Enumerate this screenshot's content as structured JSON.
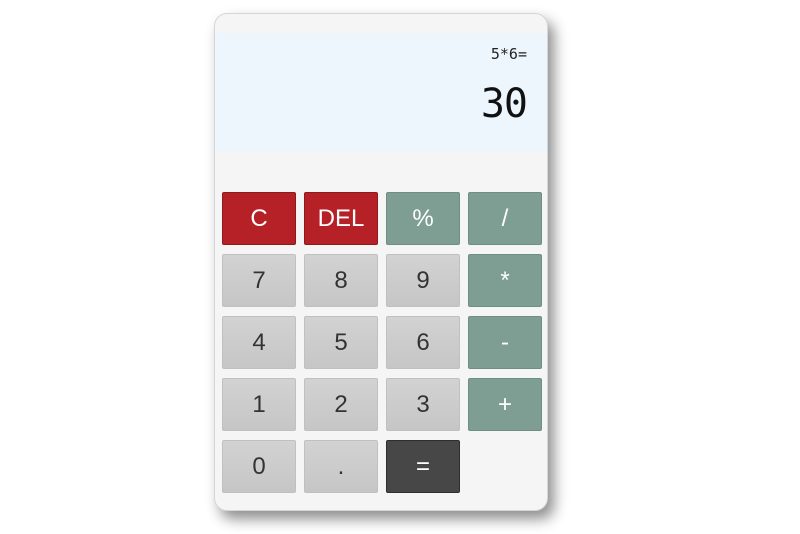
{
  "display": {
    "expression": "5*6=",
    "result": "30"
  },
  "keys": {
    "clear": "C",
    "delete": "DEL",
    "percent": "%",
    "divide": "/",
    "seven": "7",
    "eight": "8",
    "nine": "9",
    "multiply": "*",
    "four": "4",
    "five": "5",
    "six": "6",
    "subtract": "-",
    "one": "1",
    "two": "2",
    "three": "3",
    "add": "+",
    "zero": "0",
    "decimal": ".",
    "equals": "="
  },
  "colors": {
    "clear_key": "#b52127",
    "operator_key": "#7e9e93",
    "equals_key": "#474747",
    "number_key": "#cccccc",
    "display_bg": "#eef6fd"
  }
}
